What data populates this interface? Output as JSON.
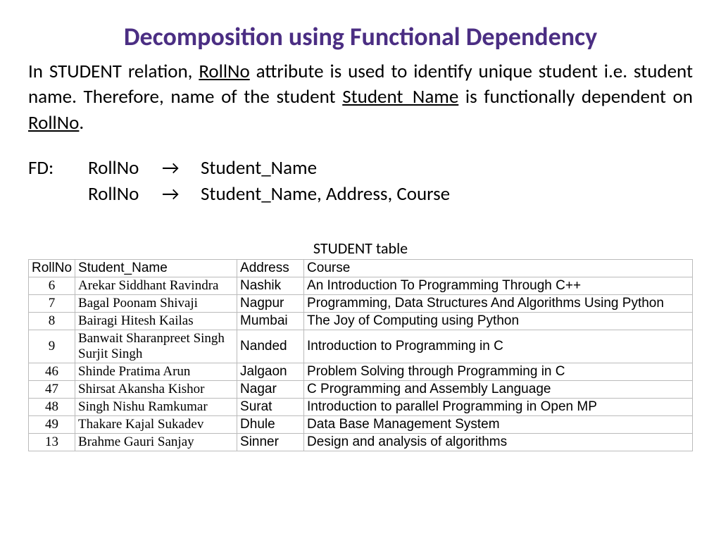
{
  "title": "Decomposition using Functional Dependency",
  "para": {
    "p1": "In STUDENT relation, ",
    "u1": "RollNo",
    "p2": " attribute is used to identify unique student i.e. student name. Therefore, name of the student ",
    "u2": "Student_Name",
    "p3": " is functionally dependent on ",
    "u3": "RollNo",
    "p4": "."
  },
  "fd": {
    "label": "FD:",
    "lhs1": "RollNo",
    "arrow": "→",
    "rhs1": "Student_Name",
    "lhs2": "RollNo",
    "rhs2": "Student_Name, Address, Course"
  },
  "table": {
    "caption": "STUDENT table",
    "headers": {
      "c0": "RollNo",
      "c1": "Student_Name",
      "c2": "Address",
      "c3": "Course"
    },
    "rows": [
      {
        "rollno": "6",
        "name": "Arekar Siddhant Ravindra",
        "addr": "Nashik",
        "course": "An Introduction To Programming Through C++"
      },
      {
        "rollno": "7",
        "name": "Bagal Poonam Shivaji",
        "addr": "Nagpur",
        "course": "Programming, Data Structures And Algorithms Using Python"
      },
      {
        "rollno": "8",
        "name": "Bairagi Hitesh Kailas",
        "addr": "Mumbai",
        "course": "The Joy of Computing using Python"
      },
      {
        "rollno": "9",
        "name": "Banwait Sharanpreet Singh Surjit Singh",
        "addr": "Nanded",
        "course": "Introduction to Programming in C"
      },
      {
        "rollno": "46",
        "name": "Shinde Pratima Arun",
        "addr": "Jalgaon",
        "course": "Problem Solving through Programming in C"
      },
      {
        "rollno": "47",
        "name": "Shirsat Akansha Kishor",
        "addr": "Nagar",
        "course": "C Programming and Assembly Language"
      },
      {
        "rollno": "48",
        "name": "Singh Nishu Ramkumar",
        "addr": "Surat",
        "course": "Introduction to parallel Programming in Open MP"
      },
      {
        "rollno": "49",
        "name": "Thakare Kajal Sukadev",
        "addr": "Dhule",
        "course": "Data Base Management System"
      },
      {
        "rollno": "13",
        "name": "Brahme Gauri Sanjay",
        "addr": "Sinner",
        "course": "Design and analysis of algorithms"
      }
    ]
  }
}
